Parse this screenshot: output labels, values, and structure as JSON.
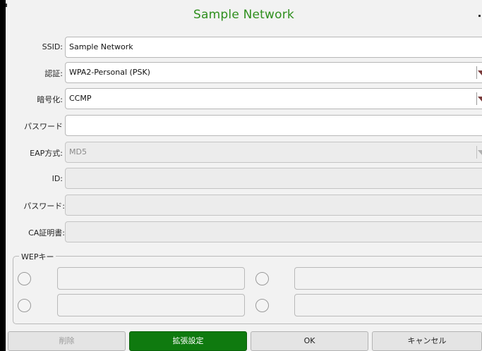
{
  "window": {
    "title": "Sample Network"
  },
  "form": {
    "ssid": {
      "label": "SSID:",
      "value": "Sample Network"
    },
    "auth": {
      "label": "認証:",
      "value": "WPA2-Personal (PSK)"
    },
    "encryption": {
      "label": "暗号化:",
      "value": "CCMP"
    },
    "password": {
      "label": "パスワード",
      "value": ""
    },
    "eap_method": {
      "label": "EAP方式:",
      "value": "MD5"
    },
    "identity": {
      "label": "ID:",
      "value": ""
    },
    "eap_password": {
      "label": "パスワード:",
      "value": ""
    },
    "ca_cert": {
      "label": "CA証明書:",
      "value": ""
    }
  },
  "wep": {
    "legend": "WEPキー",
    "keys": [
      "",
      "",
      "",
      ""
    ]
  },
  "buttons": {
    "delete": "削除",
    "advanced": "拡張設定",
    "ok": "OK",
    "cancel": "キャンセル"
  },
  "colors": {
    "title_green": "#2f8f1e",
    "primary_button": "#0f7a0f",
    "dropdown_arrow": "#7a3a3a"
  },
  "icons": {
    "dropdown": "chevron-down-icon",
    "radio": "radio-unchecked"
  }
}
